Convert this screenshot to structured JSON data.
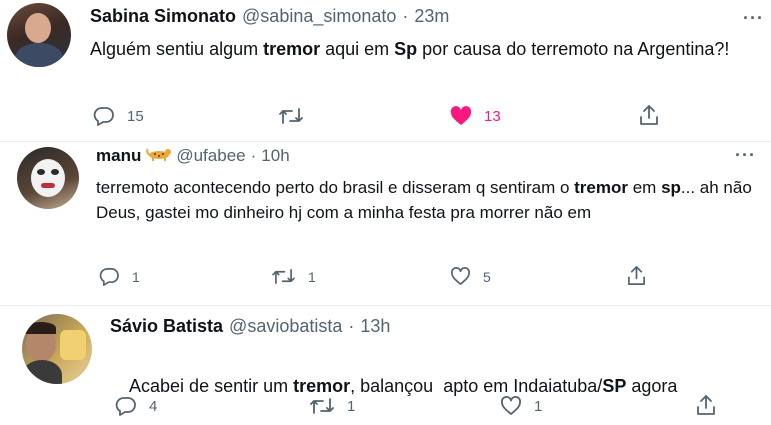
{
  "tweets": [
    {
      "name": "Sabina Simonato",
      "handle": "@sabina_simonato",
      "sep": "·",
      "time": "23m",
      "text": [
        "Alguém sentiu algum ",
        "tremor",
        " aqui em ",
        "Sp",
        " por causa do terremoto na Argentina?!"
      ],
      "replies": "15",
      "retweets": "",
      "likes": "13",
      "liked": true
    },
    {
      "name": "manu",
      "handle": "@ufabee",
      "sep": "·",
      "time": "10h",
      "text": [
        "terremoto acontecendo perto do brasil e disseram q sentiram o ",
        "tremor",
        " em ",
        "sp",
        "... ah não Deus, gastei mo dinheiro hj com a minha festa pra morrer não em"
      ],
      "replies": "1",
      "retweets": "1",
      "likes": "5",
      "liked": false
    },
    {
      "name": "Sávio Batista",
      "handle": "@saviobatista",
      "sep": "·",
      "time": "13h",
      "text": [
        "Acabei de sentir um ",
        "tremor",
        ", balançou  apto em Indaiatuba/",
        "SP",
        " agora"
      ],
      "replies": "4",
      "retweets": "1",
      "likes": "1",
      "liked": false
    }
  ],
  "icons": {
    "more": "more-icon",
    "reply": "reply-icon",
    "retweet": "retweet-icon",
    "like": "heart-icon",
    "share": "share-icon",
    "badge": "leopard-emoji"
  },
  "colors": {
    "liked": "#f91880",
    "muted": "#536471",
    "divider": "#e6ecf0"
  }
}
